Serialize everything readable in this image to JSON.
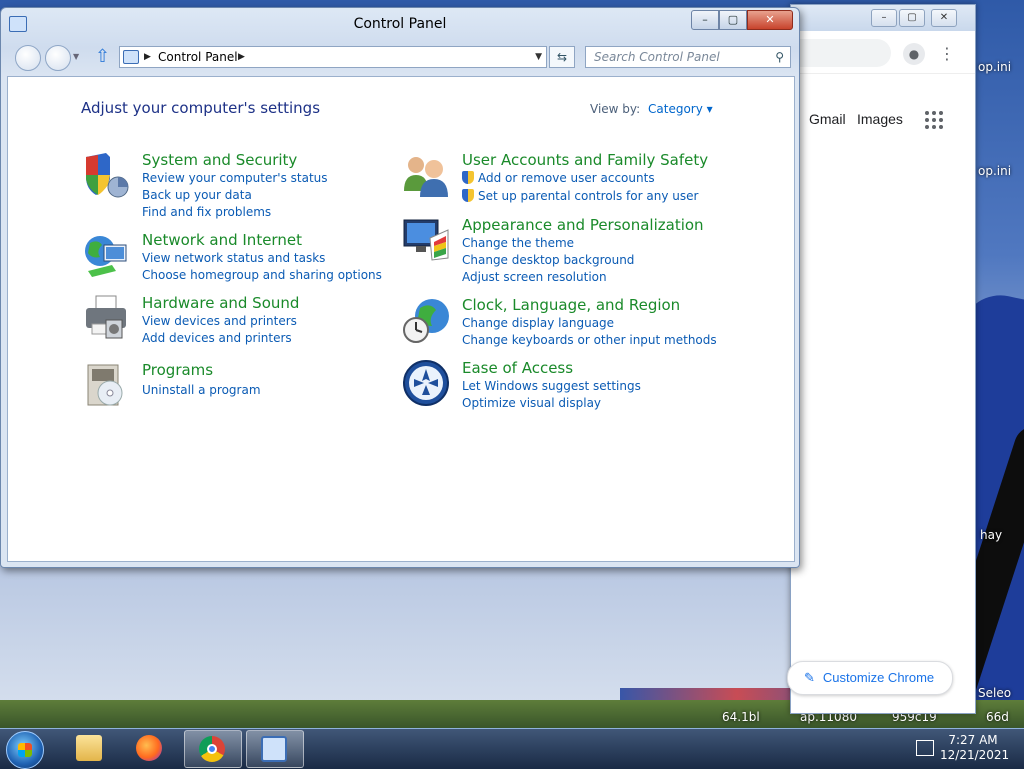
{
  "desktop": {
    "labels": [
      "op.ini",
      "op.ini",
      "hay",
      "Seleo",
      "66d",
      "64.1bl",
      "ap.11080",
      "959c19"
    ]
  },
  "chrome_window": {
    "links": [
      "Gmail",
      "Images"
    ],
    "customize_label": "Customize Chrome",
    "controls": [
      "–",
      "▢",
      "✕"
    ]
  },
  "control_panel": {
    "title": "Control Panel",
    "address": "Control Panel",
    "search_placeholder": "Search Control Panel",
    "heading": "Adjust your computer's settings",
    "view_by_label": "View by:",
    "view_by_value": "Category ▾",
    "window_controls": [
      "–",
      "▢",
      "✕"
    ],
    "categories": [
      {
        "title": "System and Security",
        "icon": "shield-icon",
        "links": [
          "Review your computer's status",
          "Back up your data",
          "Find and fix problems"
        ]
      },
      {
        "title": "Network and Internet",
        "icon": "globe-network-icon",
        "links": [
          "View network status and tasks",
          "Choose homegroup and sharing options"
        ]
      },
      {
        "title": "Hardware and Sound",
        "icon": "printer-icon",
        "links": [
          "View devices and printers",
          "Add devices and printers"
        ]
      },
      {
        "title": "Programs",
        "icon": "programs-icon",
        "links": [
          "Uninstall a program"
        ]
      },
      {
        "title": "User Accounts and Family Safety",
        "icon": "users-icon",
        "links": [
          "Add or remove user accounts",
          "Set up parental controls for any user"
        ]
      },
      {
        "title": "Appearance and Personalization",
        "icon": "monitor-palette-icon",
        "links": [
          "Change the theme",
          "Change desktop background",
          "Adjust screen resolution"
        ]
      },
      {
        "title": "Clock, Language, and Region",
        "icon": "clock-globe-icon",
        "links": [
          "Change display language",
          "Change keyboards or other input methods"
        ]
      },
      {
        "title": "Ease of Access",
        "icon": "ease-of-access-icon",
        "links": [
          "Let Windows suggest settings",
          "Optimize visual display"
        ]
      }
    ]
  },
  "taskbar": {
    "apps": [
      "windows-explorer-icon",
      "firefox-icon",
      "chrome-icon",
      "control-panel-icon"
    ],
    "time": "7:27 AM",
    "date": "12/21/2021"
  },
  "colors": {
    "category_title": "#1a8a2a",
    "link": "#0b5bb4",
    "heading": "#1e3287"
  }
}
